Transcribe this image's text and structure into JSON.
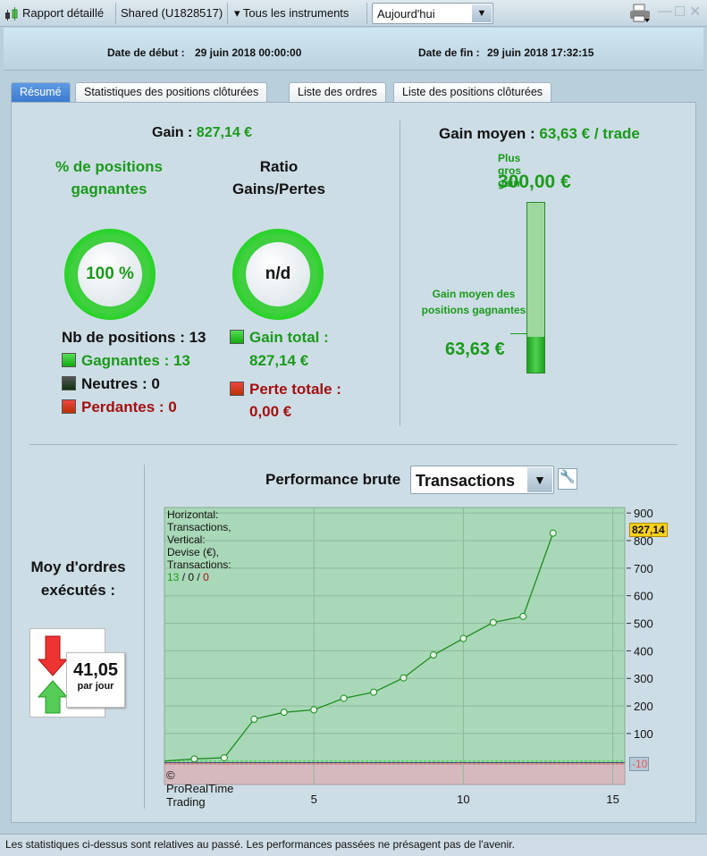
{
  "titlebar": {
    "app_title": "Rapport détaillé",
    "account": "Shared (U1828517)",
    "instruments": "Tous les instruments",
    "period": "Aujourd'hui",
    "icons": [
      "candlestick-icon",
      "printer-icon",
      "minimize-icon",
      "maximize-icon",
      "close-icon"
    ]
  },
  "header": {
    "start_label": "Date de début :",
    "start_value": "29 juin 2018 00:00:00",
    "end_label": "Date de fin :",
    "end_value": "29 juin 2018 17:32:15"
  },
  "tabs": [
    {
      "label": "Résumé",
      "active": true
    },
    {
      "label": "Statistiques des positions clôturées"
    },
    {
      "label": "Liste des ordres"
    },
    {
      "label": "Liste des positions clôturées"
    }
  ],
  "summary": {
    "gain_label": "Gain :",
    "gain_value": "827,14 €",
    "win_pct_title": "% de positions gagnantes",
    "win_pct": "100 %",
    "ratio_title": "Ratio Gains/Pertes",
    "ratio": "n/d",
    "nb_positions": "Nb de positions : 13",
    "winners": "Gagnantes : 13",
    "neutral": "Neutres : 0",
    "losers": "Perdantes : 0",
    "total_gain_label": "Gain total :",
    "total_gain": "827,14 €",
    "total_loss_label": "Perte totale :",
    "total_loss": "0,00 €",
    "avg_gain_label": "Gain moyen :",
    "avg_gain": "63,63 € / trade",
    "biggest_gain_label": "Plus gros gain",
    "biggest_gain": "300,00 €",
    "avg_win_label": "Gain moyen des positions gagnantes",
    "avg_win": "63,63 €",
    "avg_win_fraction": 0.2121,
    "orders_label": "Moy d'ordres exécutés :",
    "orders_value": "41,05",
    "orders_unit": "par jour"
  },
  "performance": {
    "title": "Performance brute",
    "mode": "Transactions",
    "info_prefix": "Horizontal: Transactions, Vertical: Devise (€), Transactions: ",
    "info_win": "13",
    "info_neutral": "0",
    "info_loss": "0",
    "copyright": "© ProRealTime Trading",
    "last_value_label": "827,14",
    "min_label": "-10"
  },
  "chart_data": {
    "type": "line",
    "xlim": [
      0,
      15.4
    ],
    "ylim": [
      -85,
      920
    ],
    "x": [
      0,
      1,
      2,
      3,
      4,
      5,
      6,
      7,
      8,
      9,
      10,
      11,
      12,
      13
    ],
    "y": [
      0,
      8,
      12,
      152,
      177,
      186,
      228,
      250,
      302,
      385,
      445,
      503,
      525,
      827.14
    ],
    "xticks": [
      5,
      10,
      15
    ],
    "yticks": [
      100,
      200,
      300,
      400,
      500,
      600,
      700,
      800,
      900
    ],
    "grid": true,
    "colors": {
      "line": "#1e8c1e",
      "positive_area": "#a9d8b8",
      "negative_area": "#d5b9be"
    }
  },
  "footer": {
    "disclaimer": "Les statistiques ci-dessus sont relatives au passé. Les performances passées ne présagent pas de l'avenir."
  }
}
